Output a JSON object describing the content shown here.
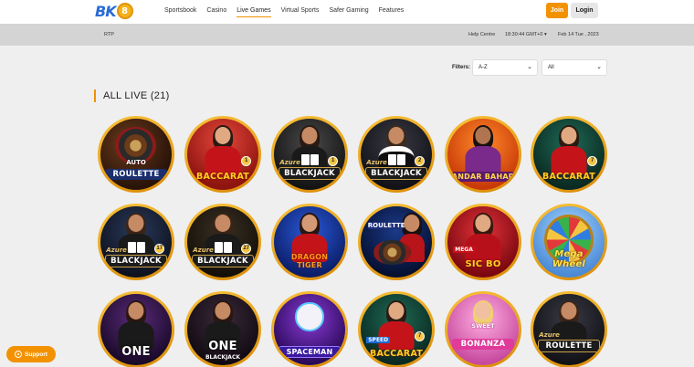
{
  "header": {
    "logo_text": "BK",
    "logo_coin": "8",
    "nav": [
      "Sportsbook",
      "Casino",
      "Live Games",
      "Virtual Sports",
      "Safer Gaming",
      "Features"
    ],
    "nav_active_index": 2,
    "join_label": "Join",
    "login_label": "Login"
  },
  "infobar": {
    "rtp": "RTP",
    "help": "Help Centre",
    "time": "18:30:44 GMT+0",
    "time_chevron": "▾",
    "date": "Feb 14 Tue , 2023"
  },
  "filters": {
    "label": "Filters:",
    "sort_value": "A-Z",
    "category_value": "All"
  },
  "section": {
    "title": "ALL LIVE (21)"
  },
  "games": [
    {
      "label": "ROULETTE",
      "sub": "AUTO",
      "theme": "auto-roulette"
    },
    {
      "label": "BACCARAT",
      "badge": "1",
      "theme": "baccarat-red"
    },
    {
      "label": "BLACKJACK",
      "sub": "Azure",
      "badge": "1",
      "theme": "blackjack-azure"
    },
    {
      "label": "BLACKJACK",
      "sub": "Azure",
      "badge": "2",
      "theme": "blackjack-man"
    },
    {
      "label": "ANDAR BAHAR",
      "theme": "andar-bahar"
    },
    {
      "label": "BACCARAT",
      "badge": "7",
      "theme": "baccarat-green"
    },
    {
      "label": "BLACKJACK",
      "sub": "Azure",
      "badge": "17",
      "theme": "blackjack-17"
    },
    {
      "label": "BLACKJACK",
      "sub": "Azure",
      "badge": "27",
      "theme": "blackjack-27"
    },
    {
      "label": "DRAGON TIGER",
      "theme": "dragon-tiger"
    },
    {
      "label": "ROULETTE",
      "theme": "roulette-blue"
    },
    {
      "label": "SIC BO",
      "sub": "MEGA",
      "theme": "sic-bo"
    },
    {
      "label": "Mega Wheel",
      "theme": "mega-wheel"
    },
    {
      "label": "ONE",
      "theme": "one-bj"
    },
    {
      "label": "ONE",
      "sub": "BLACKJACK",
      "theme": "ruby-one-bj"
    },
    {
      "label": "SPACEMAN",
      "theme": "spaceman"
    },
    {
      "label": "BACCARAT",
      "sub": "SPEED",
      "badge": "7",
      "theme": "speed-baccarat"
    },
    {
      "label": "BONANZA",
      "sub": "SWEET",
      "theme": "sweet-bonanza"
    },
    {
      "label": "ROULETTE",
      "sub": "Azure",
      "theme": "roulette-azure"
    }
  ],
  "support": {
    "label": "Support"
  },
  "colors": {
    "accent": "#f39200",
    "brand_blue": "#2a6bd6",
    "tile_ring": "#e8a11a"
  }
}
